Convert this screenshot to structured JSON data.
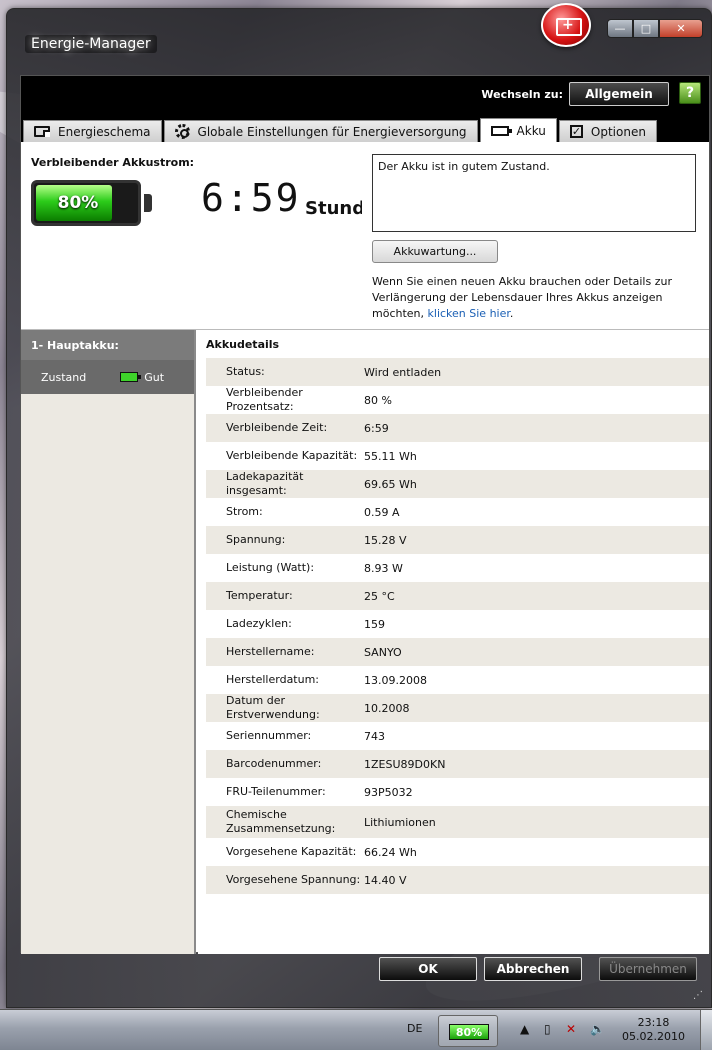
{
  "window": {
    "title": "Energie-Manager",
    "minimize": "—",
    "maximize": "□",
    "close": "✕"
  },
  "topbar": {
    "switch_label": "Wechseln zu:",
    "switch_button": "Allgemein",
    "help": "?"
  },
  "tabs": [
    {
      "label": "Energieschema",
      "icon": "power-plan-icon"
    },
    {
      "label": "Globale Einstellungen für Energieversorgung",
      "icon": "gear-icon"
    },
    {
      "label": "Akku",
      "icon": "battery-icon",
      "active": true
    },
    {
      "label": "Optionen",
      "icon": "checkbox-icon"
    }
  ],
  "summary": {
    "remaining_label": "Verbleibender Akkustrom:",
    "percent_text": "80%",
    "percent_value": 80,
    "time": "6:59",
    "time_unit": "Stunden",
    "status_text": "Der Akku ist in gutem Zustand.",
    "maintenance_button": "Akkuwartung...",
    "info_text": "Wenn Sie einen neuen Akku brauchen oder Details zur Verlängerung der Lebensdauer Ihres Akkus anzeigen möchten,",
    "info_link": "klicken Sie hier",
    "info_end": "."
  },
  "battery_list": {
    "header": "1- Hauptakku:",
    "state_label": "Zustand",
    "state_value": "Gut"
  },
  "details": {
    "title": "Akkudetails",
    "rows": [
      {
        "k": "Status:",
        "v": "Wird entladen"
      },
      {
        "k": "Verbleibender Prozentsatz:",
        "v": "80 %"
      },
      {
        "k": "Verbleibende Zeit:",
        "v": "6:59"
      },
      {
        "k": "Verbleibende Kapazität:",
        "v": "55.11 Wh"
      },
      {
        "k": "Ladekapazität insgesamt:",
        "v": "69.65 Wh"
      },
      {
        "k": "Strom:",
        "v": "0.59 A"
      },
      {
        "k": "Spannung:",
        "v": "15.28 V"
      },
      {
        "k": "Leistung (Watt):",
        "v": "8.93 W"
      },
      {
        "k": "Temperatur:",
        "v": "25 °C"
      },
      {
        "k": "Ladezyklen:",
        "v": "159"
      },
      {
        "k": "Herstellername:",
        "v": "SANYO"
      },
      {
        "k": "Herstellerdatum:",
        "v": "13.09.2008"
      },
      {
        "k": "Datum der Erstverwendung:",
        "v": "10.2008"
      },
      {
        "k": "Seriennummer:",
        "v": "743"
      },
      {
        "k": "Barcodenummer:",
        "v": "1ZESU89D0KN"
      },
      {
        "k": "FRU-Teilenummer:",
        "v": "93P5032"
      },
      {
        "k": "Chemische Zusammensetzung:",
        "v": "Lithiumionen"
      },
      {
        "k": "Vorgesehene Kapazität:",
        "v": "66.24 Wh"
      },
      {
        "k": "Vorgesehene Spannung:",
        "v": "14.40 V"
      }
    ]
  },
  "buttons": {
    "ok": "OK",
    "cancel": "Abbrechen",
    "apply": "Übernehmen"
  },
  "taskbar": {
    "language": "DE",
    "battery": "80%",
    "time": "23:18",
    "date": "05.02.2010"
  }
}
